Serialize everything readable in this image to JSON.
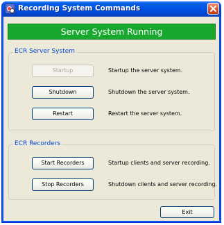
{
  "window": {
    "title": "Recording System Commands",
    "close_icon": "close-icon",
    "app_icon": "recording-app-icon"
  },
  "status": {
    "text": "Server System Running",
    "color": "#17a82d"
  },
  "server_group": {
    "title": "ECR Server System",
    "startup": {
      "label": "Startup",
      "description": "Startup the server system.",
      "enabled": false
    },
    "shutdown": {
      "label": "Shutdown",
      "description": "Shutdown the server system.",
      "enabled": true
    },
    "restart": {
      "label": "Restart",
      "description": "Restart the server system.",
      "enabled": true
    }
  },
  "recorders_group": {
    "title": "ECR Recorders",
    "start": {
      "label": "Start Recorders",
      "description": "Startup clients and server recording."
    },
    "stop": {
      "label": "Stop Recorders",
      "description": "Shutdown clients and server recording."
    }
  },
  "footer": {
    "exit_label": "Exit"
  }
}
